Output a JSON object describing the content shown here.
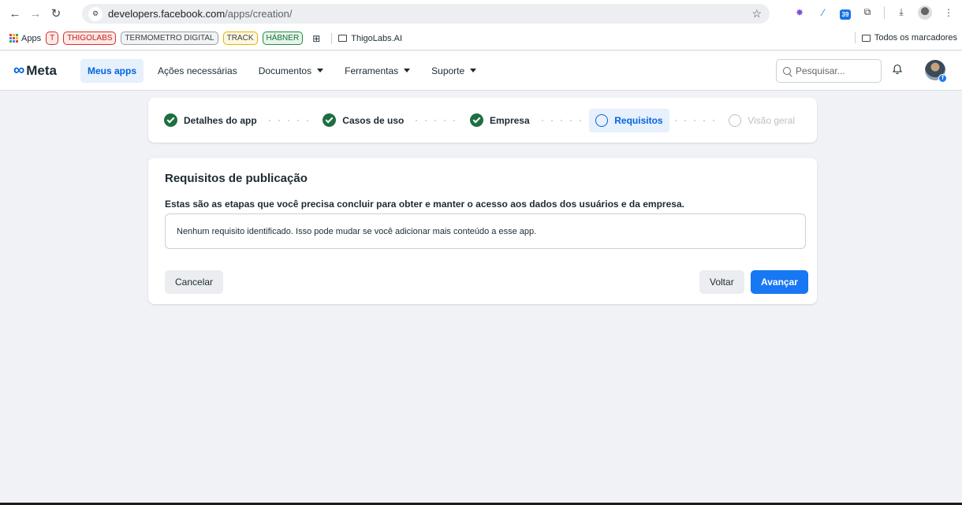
{
  "browser": {
    "url_host": "developers.facebook.com",
    "url_path": "/apps/creation/",
    "calendar_badge": "39"
  },
  "bookmarks": {
    "apps_label": "Apps",
    "items": [
      "T",
      "THIGOLABS",
      "TERMOMETRO DIGITAL",
      "TRACK",
      "HÁBNER"
    ],
    "folder_label": "ThigoLabs.AI",
    "all_bookmarks_label": "Todos os marcadores"
  },
  "header": {
    "logo_text": "Meta",
    "nav": {
      "my_apps": "Meus apps",
      "actions": "Ações necessárias",
      "docs": "Documentos",
      "tools": "Ferramentas",
      "support": "Suporte"
    },
    "search_placeholder": "Pesquisar..."
  },
  "stepper": {
    "steps": [
      {
        "label": "Detalhes do app",
        "state": "done"
      },
      {
        "label": "Casos de uso",
        "state": "done"
      },
      {
        "label": "Empresa",
        "state": "done"
      },
      {
        "label": "Requisitos",
        "state": "current"
      },
      {
        "label": "Visão geral",
        "state": "pending"
      }
    ]
  },
  "card": {
    "title": "Requisitos de publicação",
    "subtitle": "Estas são as etapas que você precisa concluir para obter e manter o acesso aos dados dos usuários e da empresa.",
    "message": "Nenhum requisito identificado. Isso pode mudar se você adicionar mais conteúdo a esse app.",
    "cancel": "Cancelar",
    "back": "Voltar",
    "next": "Avançar"
  },
  "colors": {
    "accent": "#1877f2",
    "meta_blue": "#0064e0",
    "done_green": "#1d6f42",
    "page_bg": "#f0f2f5"
  }
}
